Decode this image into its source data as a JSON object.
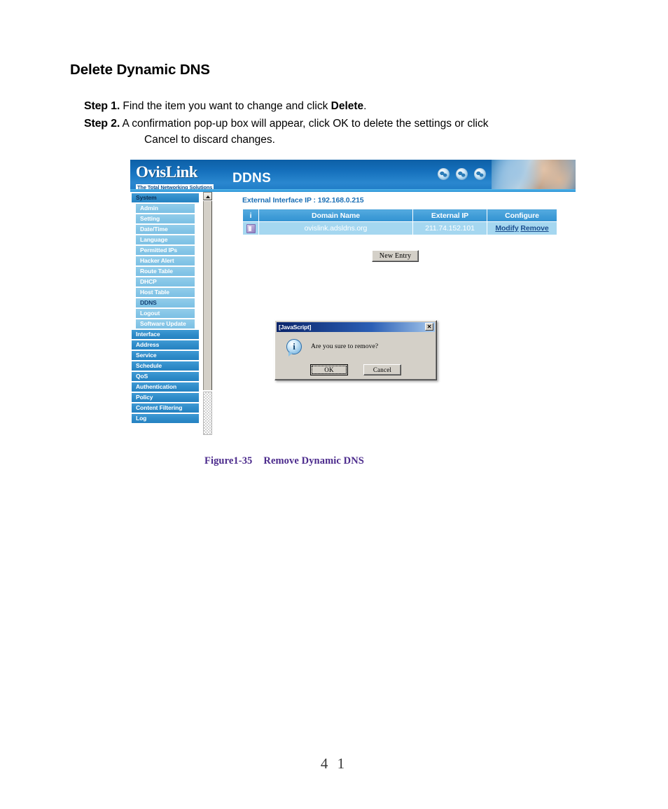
{
  "document": {
    "title": "Delete Dynamic DNS",
    "steps": [
      {
        "label": "Step 1.",
        "text_before": "Find the item you want to change and click ",
        "bold": "Delete",
        "text_after": "."
      },
      {
        "label": "Step 2.",
        "text_before": "A confirmation pop-up box will appear, click OK to delete the settings or click",
        "bold": "",
        "text_after": "",
        "continuation": "Cancel to discard changes."
      }
    ],
    "caption_figure": "Figure1-35",
    "caption_text": "Remove Dynamic DNS",
    "page_number": "4 1"
  },
  "screenshot": {
    "banner": {
      "logo_main": "OvisLink",
      "logo_sub": "The Total Networking Solutions",
      "page_title": "DDNS",
      "globe_icons": [
        "globe-icon",
        "globe-icon",
        "globe-icon"
      ]
    },
    "sidebar": {
      "groups": [
        {
          "label": "System",
          "selected": true,
          "items": [
            {
              "label": "Admin",
              "selected": false
            },
            {
              "label": "Setting",
              "selected": false
            },
            {
              "label": "Date/Time",
              "selected": false
            },
            {
              "label": "Language",
              "selected": false
            },
            {
              "label": "Permitted IPs",
              "selected": false
            },
            {
              "label": "Hacker Alert",
              "selected": false
            },
            {
              "label": "Route Table",
              "selected": false
            },
            {
              "label": "DHCP",
              "selected": false
            },
            {
              "label": "Host Table",
              "selected": false
            },
            {
              "label": "DDNS",
              "selected": true
            },
            {
              "label": "Logout",
              "selected": false
            },
            {
              "label": "Software Update",
              "selected": false
            }
          ]
        },
        {
          "label": "Interface",
          "items": []
        },
        {
          "label": "Address",
          "items": []
        },
        {
          "label": "Service",
          "items": []
        },
        {
          "label": "Schedule",
          "items": []
        },
        {
          "label": "QoS",
          "items": []
        },
        {
          "label": "Authentication",
          "items": []
        },
        {
          "label": "Policy",
          "items": []
        },
        {
          "label": "Content Filtering",
          "items": []
        },
        {
          "label": "Log",
          "items": []
        }
      ]
    },
    "main": {
      "external_interface_label": "External Interface IP : 192.168.0.215",
      "table": {
        "headers": [
          "i",
          "Domain Name",
          "External IP",
          "Configure"
        ],
        "rows": [
          {
            "icon": "ddns-entry-icon",
            "domain_name": "ovislink.adsldns.org",
            "external_ip": "211.74.152.101",
            "modify_label": "Modify",
            "remove_label": "Remove"
          }
        ]
      },
      "new_entry_button": "New Entry"
    },
    "dialog": {
      "title": "[JavaScript]",
      "close_label": "✕",
      "icon": "info-icon",
      "message": "Are you sure to remove?",
      "ok_label": "OK",
      "cancel_label": "Cancel"
    }
  },
  "colors": {
    "banner_blue": "#1570bc",
    "accent_blue": "#3493d2",
    "menu_item_blue": "#86c6e7",
    "row_blue": "#a5d7f0",
    "caption_purple": "#4b2a8c",
    "link_blue": "#1b4f8f",
    "dialog_face": "#d4d0c8",
    "dialog_title_blue": "#0a246a"
  }
}
